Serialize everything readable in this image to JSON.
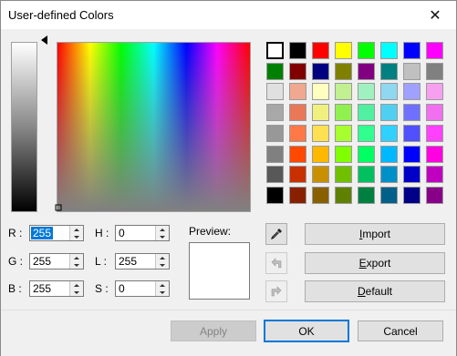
{
  "window": {
    "title": "User-defined Colors",
    "close_glyph": "✕"
  },
  "palette": {
    "selected_index": 0,
    "colors": [
      "#ffffff",
      "#000000",
      "#ff0000",
      "#ffff00",
      "#00ff00",
      "#00ffff",
      "#0000ff",
      "#ff00ff",
      "#008000",
      "#800000",
      "#000080",
      "#808000",
      "#800080",
      "#008080",
      "#c0c0c0",
      "#808080",
      "#e0e0e0",
      "#f0a890",
      "#ffffc0",
      "#c0f090",
      "#a0f0c0",
      "#90d8f0",
      "#a0a0ff",
      "#f8a0f0",
      "#a8a8a8",
      "#e87858",
      "#f0f080",
      "#90f050",
      "#50f0a0",
      "#50d0f0",
      "#7070ff",
      "#f070f0",
      "#989898",
      "#ff7848",
      "#ffe050",
      "#a8ff30",
      "#30ff90",
      "#30d0ff",
      "#5050ff",
      "#ff40ff",
      "#808080",
      "#ff4800",
      "#ffb800",
      "#80ff00",
      "#00ff60",
      "#00b8ff",
      "#0000ff",
      "#ff00e0",
      "#585858",
      "#c83000",
      "#c89000",
      "#70c000",
      "#00c060",
      "#0090c8",
      "#0000c8",
      "#c000c0",
      "#000000",
      "#882000",
      "#886000",
      "#608000",
      "#008040",
      "#006088",
      "#000088",
      "#880088"
    ]
  },
  "fields": {
    "r": {
      "label": "R :",
      "value": "255"
    },
    "g": {
      "label": "G :",
      "value": "255"
    },
    "b": {
      "label": "B :",
      "value": "255"
    },
    "h": {
      "label": "H :",
      "value": "0"
    },
    "l": {
      "label": "L :",
      "value": "255"
    },
    "s": {
      "label": "S :",
      "value": "0"
    }
  },
  "preview": {
    "label": "Preview:",
    "color": "#ffffff"
  },
  "tools": {
    "eyedropper": "eyedropper-icon",
    "undo": "undo-icon",
    "redo": "redo-icon"
  },
  "buttons": {
    "import": {
      "pre": "",
      "key": "I",
      "post": "mport"
    },
    "export": {
      "pre": "",
      "key": "E",
      "post": "xport"
    },
    "default": {
      "pre": "",
      "key": "D",
      "post": "efault"
    },
    "apply": "Apply",
    "ok": "OK",
    "cancel": "Cancel"
  }
}
